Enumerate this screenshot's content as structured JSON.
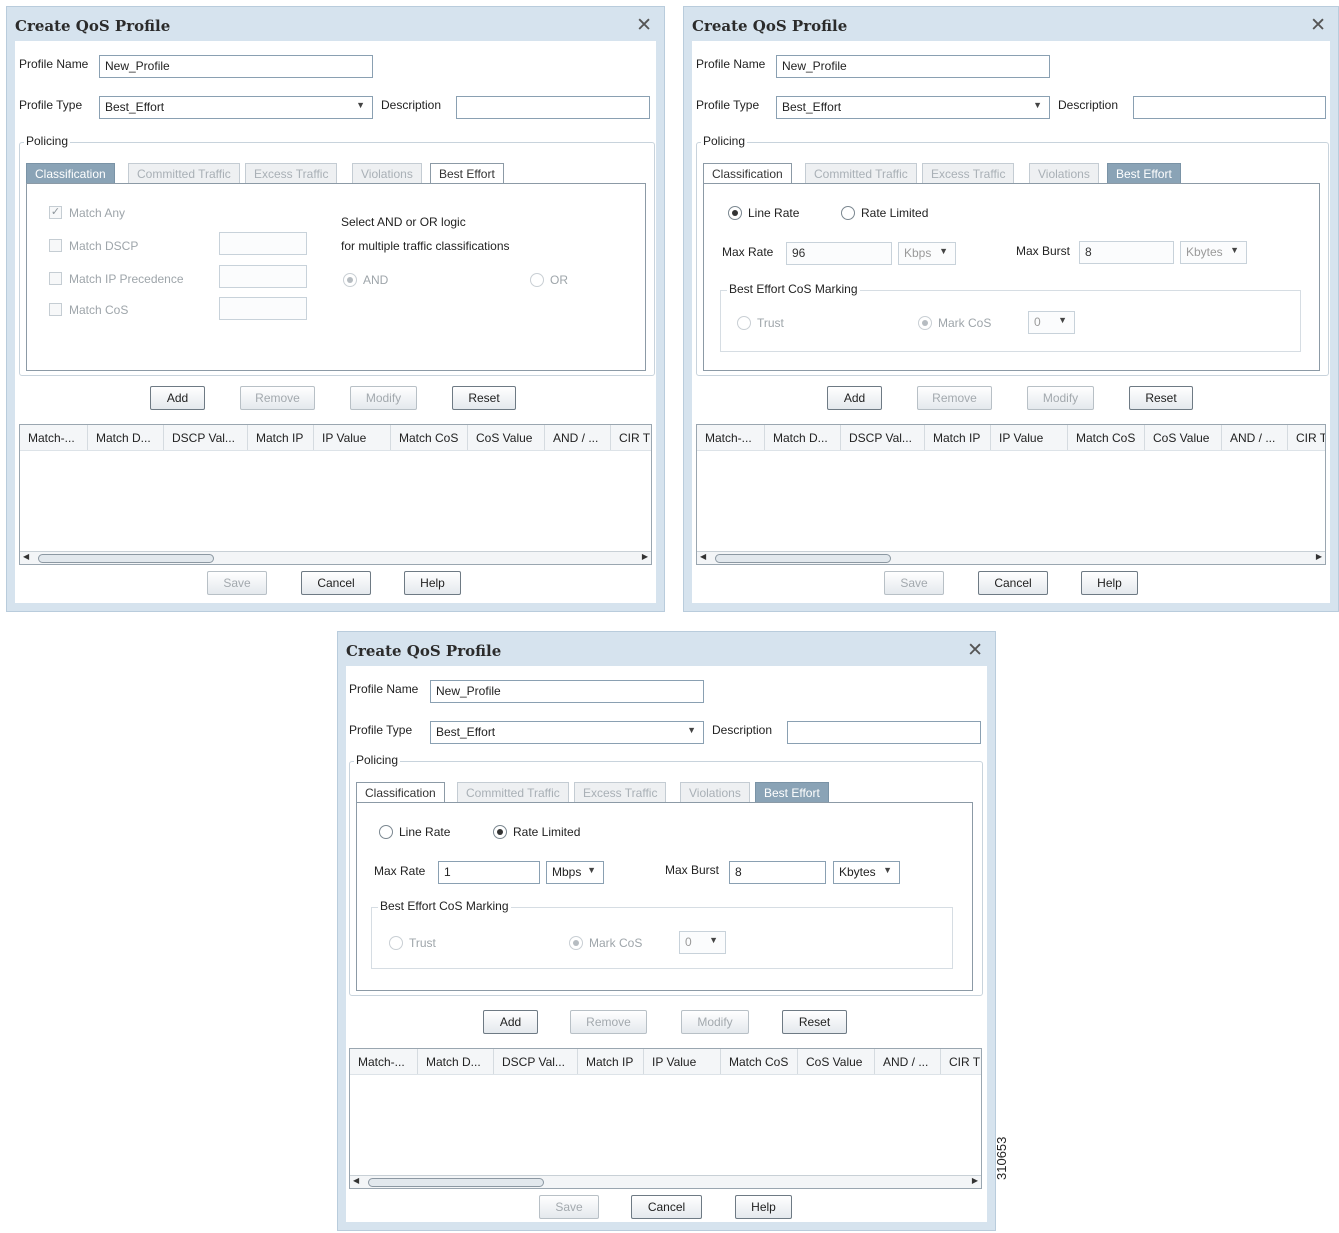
{
  "dialogs": [
    {
      "title": "Create QoS Profile",
      "profile_name_label": "Profile Name",
      "profile_name_value": "New_Profile",
      "profile_type_label": "Profile Type",
      "profile_type_value": "Best_Effort",
      "description_label": "Description",
      "description_value": "",
      "policing_label": "Policing",
      "tabs": [
        "Classification",
        "Committed Traffic",
        "Excess Traffic",
        "Violations",
        "Best Effort"
      ],
      "active_tab": "Classification",
      "classification": {
        "match_any": "Match Any",
        "match_dscp": "Match DSCP",
        "match_ip_precedence": "Match IP Precedence",
        "match_cos": "Match CoS",
        "logic_line1": "Select AND or OR logic",
        "logic_line2": "for multiple traffic classifications",
        "and_label": "AND",
        "or_label": "OR"
      },
      "buttons": {
        "add": "Add",
        "remove": "Remove",
        "modify": "Modify",
        "reset": "Reset"
      },
      "columns": [
        "Match-...",
        "Match D...",
        "DSCP Val...",
        "Match IP",
        "IP Value",
        "Match CoS",
        "CoS Value",
        "AND / ...",
        "CIR T"
      ],
      "footer": {
        "save": "Save",
        "cancel": "Cancel",
        "help": "Help"
      }
    },
    {
      "title": "Create QoS Profile",
      "profile_name_label": "Profile Name",
      "profile_name_value": "New_Profile",
      "profile_type_label": "Profile Type",
      "profile_type_value": "Best_Effort",
      "description_label": "Description",
      "description_value": "",
      "policing_label": "Policing",
      "tabs": [
        "Classification",
        "Committed Traffic",
        "Excess Traffic",
        "Violations",
        "Best Effort"
      ],
      "active_tab": "Best Effort",
      "best_effort": {
        "line_rate": "Line Rate",
        "rate_limited": "Rate Limited",
        "selected_rate": "Line Rate",
        "max_rate_label": "Max Rate",
        "max_rate_value": "96",
        "max_rate_unit": "Kbps",
        "max_burst_label": "Max Burst",
        "max_burst_value": "8",
        "max_burst_unit": "Kbytes",
        "cos_marking_label": "Best Effort CoS Marking",
        "trust_label": "Trust",
        "mark_cos_label": "Mark CoS",
        "mark_cos_value": "0"
      },
      "buttons": {
        "add": "Add",
        "remove": "Remove",
        "modify": "Modify",
        "reset": "Reset"
      },
      "columns": [
        "Match-...",
        "Match D...",
        "DSCP Val...",
        "Match IP",
        "IP Value",
        "Match CoS",
        "CoS Value",
        "AND / ...",
        "CIR T"
      ],
      "footer": {
        "save": "Save",
        "cancel": "Cancel",
        "help": "Help"
      }
    },
    {
      "title": "Create QoS Profile",
      "profile_name_label": "Profile Name",
      "profile_name_value": "New_Profile",
      "profile_type_label": "Profile Type",
      "profile_type_value": "Best_Effort",
      "description_label": "Description",
      "description_value": "",
      "policing_label": "Policing",
      "tabs": [
        "Classification",
        "Committed Traffic",
        "Excess Traffic",
        "Violations",
        "Best Effort"
      ],
      "active_tab": "Best Effort",
      "best_effort": {
        "line_rate": "Line Rate",
        "rate_limited": "Rate Limited",
        "selected_rate": "Rate Limited",
        "max_rate_label": "Max Rate",
        "max_rate_value": "1",
        "max_rate_unit": "Mbps",
        "max_burst_label": "Max Burst",
        "max_burst_value": "8",
        "max_burst_unit": "Kbytes",
        "cos_marking_label": "Best Effort CoS Marking",
        "trust_label": "Trust",
        "mark_cos_label": "Mark CoS",
        "mark_cos_value": "0"
      },
      "buttons": {
        "add": "Add",
        "remove": "Remove",
        "modify": "Modify",
        "reset": "Reset"
      },
      "columns": [
        "Match-...",
        "Match D...",
        "DSCP Val...",
        "Match IP",
        "IP Value",
        "Match CoS",
        "CoS Value",
        "AND / ...",
        "CIR T"
      ],
      "footer": {
        "save": "Save",
        "cancel": "Cancel",
        "help": "Help"
      }
    }
  ],
  "figure_number": "310653",
  "colors": {
    "frame": "#d6e3ee",
    "active_tab": "#8aa3b6",
    "title_text": "#2b2b2b"
  },
  "icons": {
    "close": "close-icon",
    "dropdown": "chevron-down-icon",
    "scroll_left": "arrow-left-icon",
    "scroll_right": "arrow-right-icon"
  }
}
